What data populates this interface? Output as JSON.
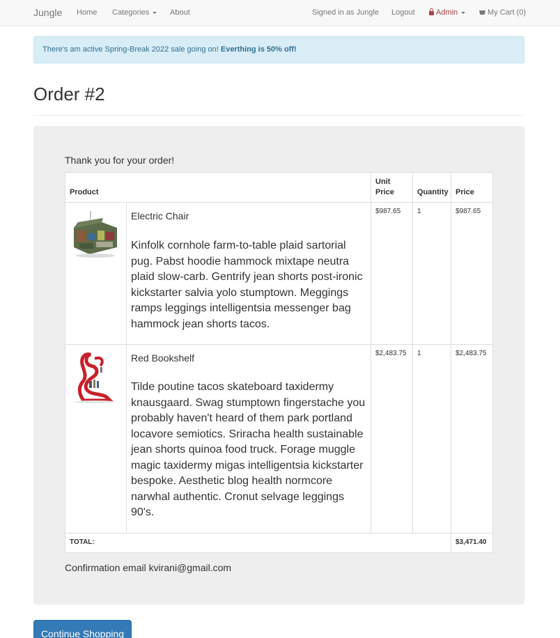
{
  "nav": {
    "brand": "Jungle",
    "home": "Home",
    "categories": "Categories",
    "about": "About",
    "signed_in": "Signed in as Jungle",
    "logout": "Logout",
    "admin": "Admin",
    "cart": "My Cart (0)"
  },
  "alert": {
    "text": "There's am active Spring-Break 2022 sale going on! ",
    "bold": "Everthing is 50% off!"
  },
  "page": {
    "title": "Order #2",
    "thanks": "Thank you for your order!",
    "confirmation": "Confirmation email kvirani@gmail.com",
    "continue_button": "Continue Shopping"
  },
  "table": {
    "headers": {
      "product": "Product",
      "unit_price_1": "Unit",
      "unit_price_2": "Price",
      "quantity": "Quantity",
      "price": "Price"
    },
    "rows": [
      {
        "name": "Electric Chair",
        "description": "Kinfolk cornhole farm-to-table plaid sartorial pug. Pabst hoodie hammock mixtape neutra plaid slow-carb. Gentrify jean shorts post-ironic kickstarter salvia yolo stumptown. Meggings ramps leggings intelligentsia messenger bag hammock jean shorts tacos.",
        "unit_price": "$987.65",
        "quantity": "1",
        "price": "$987.65"
      },
      {
        "name": "Red Bookshelf",
        "description": "Tilde poutine tacos skateboard taxidermy knausgaard. Swag stumptown fingerstache you probably haven't heard of them park portland locavore semiotics. Sriracha health sustainable jean shorts quinoa food truck. Forage muggle magic taxidermy migas intelligentsia kickstarter bespoke. Aesthetic blog health normcore narwhal authentic. Cronut selvage leggings 90's.",
        "unit_price": "$2,483.75",
        "quantity": "1",
        "price": "$2,483.75"
      }
    ],
    "total_label": "TOTAL:",
    "total_value": "$3,471.40"
  },
  "colors": {
    "accent": "#337ab7",
    "alert_bg": "#d9edf7",
    "admin": "#a94442"
  }
}
